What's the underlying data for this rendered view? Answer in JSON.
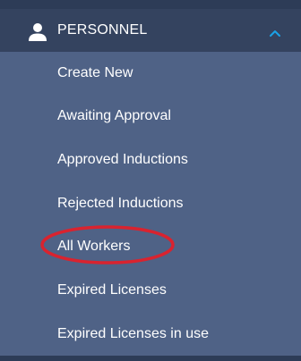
{
  "section": {
    "title": "PERSONNEL",
    "icon": "person-icon",
    "toggle_icon": "chevron-up-icon",
    "accent_color": "#1aa3e8"
  },
  "menu": {
    "items": [
      {
        "label": "Create New"
      },
      {
        "label": "Awaiting Approval"
      },
      {
        "label": "Approved Inductions"
      },
      {
        "label": "Rejected Inductions"
      },
      {
        "label": "All Workers",
        "highlighted": true
      },
      {
        "label": "Expired Licenses"
      },
      {
        "label": "Expired Licenses in use"
      }
    ]
  },
  "annotation": {
    "color": "#d9232f"
  }
}
